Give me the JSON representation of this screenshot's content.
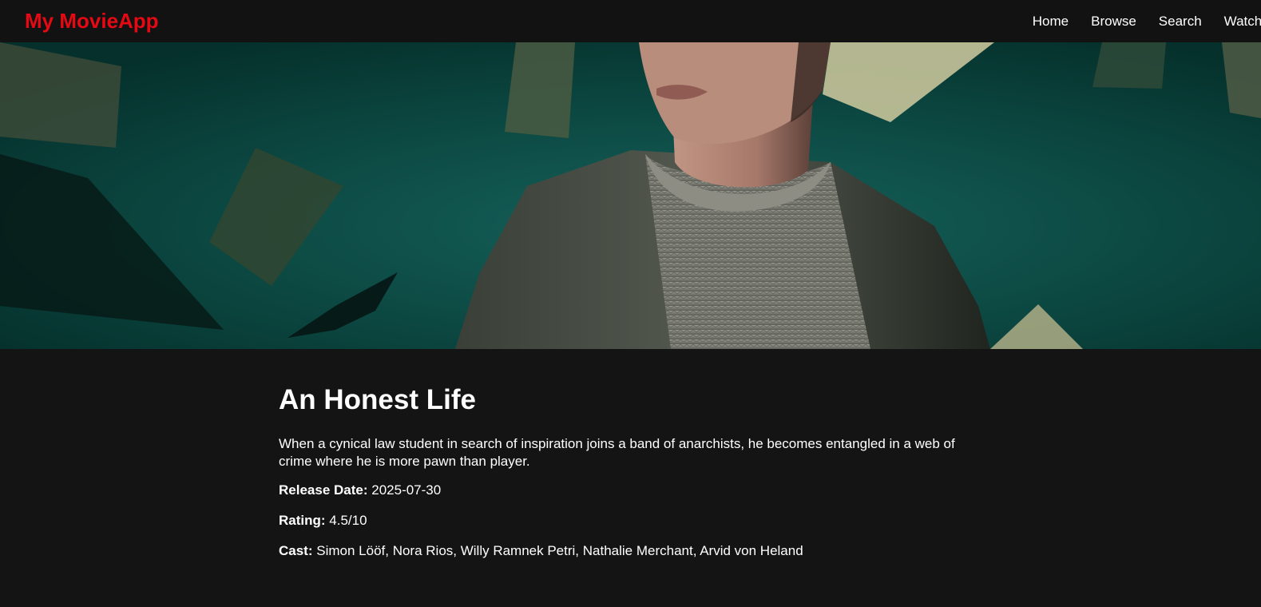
{
  "nav": {
    "brand": "My MovieApp",
    "links": [
      "Home",
      "Browse",
      "Search",
      "Watchlist"
    ]
  },
  "hero": {
    "icon": "movie-backdrop-image"
  },
  "movie": {
    "title": "An Honest Life",
    "overview": "When a cynical law student in search of inspiration joins a band of anarchists, he becomes entangled in a web of crime where he is more pawn than player.",
    "release_label": "Release Date:",
    "release_date": "2025-07-30",
    "rating_label": "Rating:",
    "rating": "4.5/10",
    "cast_label": "Cast:",
    "cast": "Simon Lööf, Nora Rios, Willy Ramnek Petri, Nathalie Merchant, Arvid von Heland"
  },
  "colors": {
    "brand": "#e50914",
    "background": "#141414",
    "navbar": "#121212",
    "text": "#ffffff"
  }
}
